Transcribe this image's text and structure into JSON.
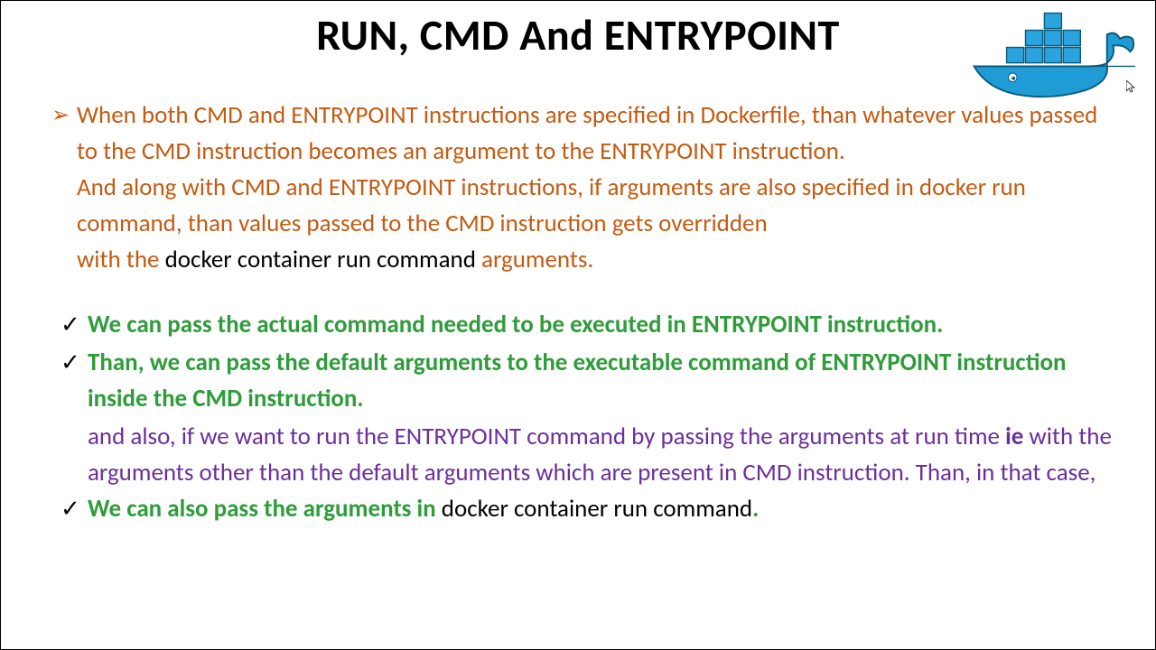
{
  "title": "RUN, CMD And ENTRYPOINT",
  "para1": {
    "l1": "When both CMD and ENTRYPOINT instructions are specified in Dockerfile, than whatever values passed to the CMD instruction becomes an argument to the ENTRYPOINT instruction.",
    "l2": "And along with CMD and ENTRYPOINT instructions, if arguments are also specified in docker run command, than values passed to the CMD instruction gets overridden",
    "l3a": "with the ",
    "l3b": "docker container run command ",
    "l3c": "arguments."
  },
  "check1": "We can pass the actual command needed to be executed in ENTRYPOINT instruction.",
  "check2": "Than, we can pass the default arguments to the executable command of ENTRYPOINT instruction inside the CMD instruction.",
  "purpleText": {
    "a": "and also, if we want to run the ENTRYPOINT command by passing the arguments at run time ",
    "b": "ie",
    "c": " with the arguments other than the default arguments which are present in CMD instruction. Than, in that case,"
  },
  "check3": {
    "a": "We can also pass the arguments in ",
    "b": "docker container run command",
    "c": "."
  }
}
